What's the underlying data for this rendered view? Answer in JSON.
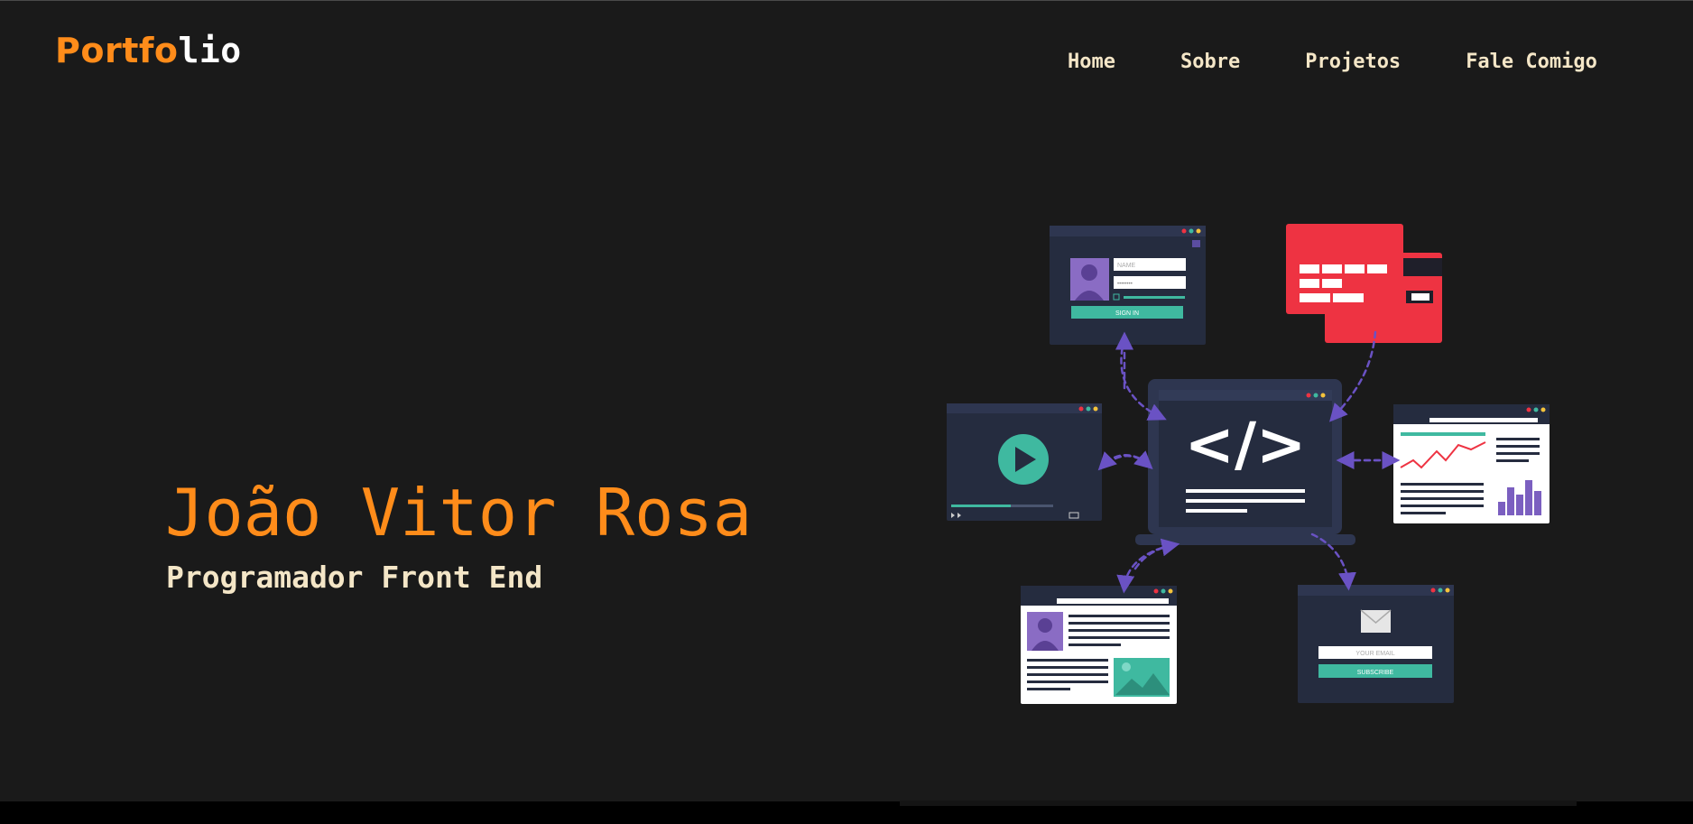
{
  "header": {
    "logo_accent": "Portfo",
    "logo_rest": "lio"
  },
  "nav": {
    "items": [
      {
        "label": "Home"
      },
      {
        "label": "Sobre"
      },
      {
        "label": "Projetos"
      },
      {
        "label": "Fale Comigo"
      }
    ]
  },
  "hero": {
    "name": "João Vitor Rosa",
    "role": "Programador Front End"
  },
  "illustration": {
    "code_symbol": "</>",
    "login_name_placeholder": "NAME",
    "login_password_placeholder": "••••••••",
    "login_button": "SIGN IN",
    "email_placeholder": "YOUR EMAIL",
    "subscribe_button": "SUBSCRIBE"
  },
  "colors": {
    "background": "#1a1a1a",
    "accent": "#ff8c1a",
    "nav_text": "#f4e6c7",
    "panel": "#252c3f",
    "teal": "#3fb9a0",
    "red": "#ee3342",
    "purple": "#7b5fc0"
  }
}
